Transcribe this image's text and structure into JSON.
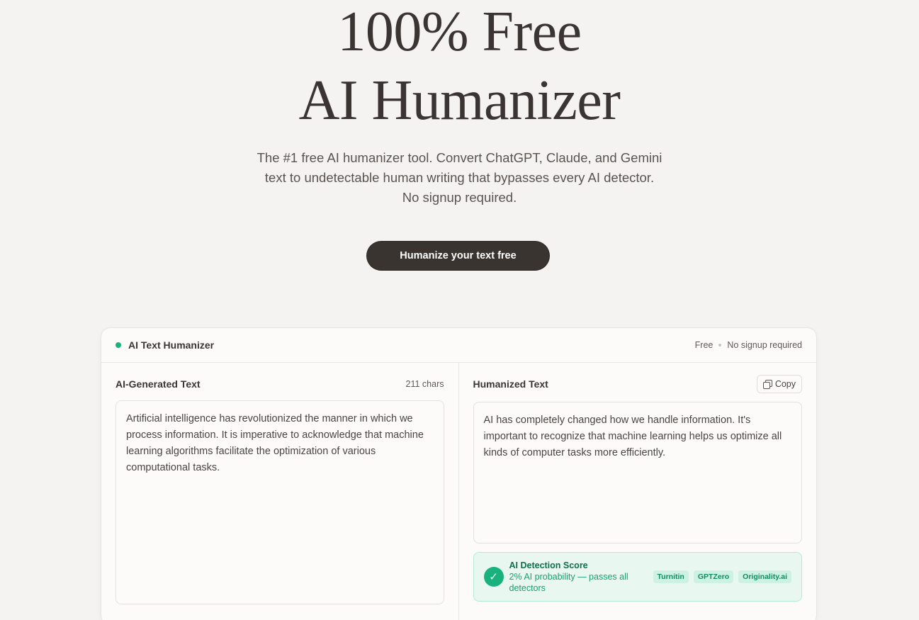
{
  "hero": {
    "title_line1": "100% Free",
    "title_line2": "AI Humanizer",
    "subtitle": "The #1 free AI humanizer tool. Convert ChatGPT, Claude, and Gemini text to undetectable human writing that bypasses every AI detector. No signup required.",
    "cta_label": "Humanize your text free"
  },
  "card": {
    "title": "AI Text Humanizer",
    "status_color": "#19b27f",
    "meta_free": "Free",
    "meta_signup": "No signup required"
  },
  "input_pane": {
    "title": "AI-Generated Text",
    "char_count": "211 chars",
    "text": "Artificial intelligence has revolutionized the manner in which we process information. It is imperative to acknowledge that machine learning algorithms facilitate the optimization of various computational tasks."
  },
  "output_pane": {
    "title": "Humanized Text",
    "copy_label": "Copy",
    "copy_icon": "copy-icon",
    "text": "AI has completely changed how we handle information. It's important to recognize that machine learning helps us optimize all kinds of computer tasks more efficiently."
  },
  "detection": {
    "title": "AI Detection Score",
    "description": "2% AI probability — passes all detectors",
    "check_icon": "check-icon",
    "check_glyph": "✓",
    "badges": [
      "Turnitin",
      "GPTZero",
      "Originality.ai"
    ]
  },
  "colors": {
    "accent_green": "#19b27f",
    "cta_bg": "#3a3431",
    "page_bg": "#f4f3f1"
  }
}
